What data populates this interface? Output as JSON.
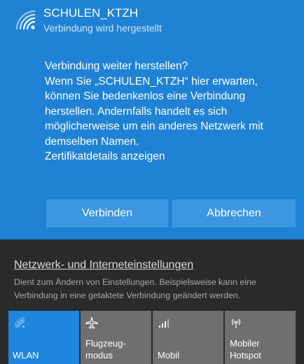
{
  "network": {
    "name": "SCHULEN_KTZH",
    "status": "Verbindung wird hergestellt"
  },
  "message": {
    "line1": "Verbindung weiter herstellen?",
    "body": "Wenn Sie „SCHULEN_KTZH“ hier erwarten, können Sie bedenkenlos eine Verbindung herstellen. Andernfalls handelt es sich möglicherweise um ein anderes Netzwerk mit demselben Namen.",
    "cert_link": "Zertifikatdetails anzeigen"
  },
  "buttons": {
    "connect": "Verbinden",
    "cancel": "Abbrechen"
  },
  "settings": {
    "link": "Netzwerk- und Interneteinstellungen",
    "description": "Dient zum Ändern von Einstellungen. Beispielsweise kann eine Verbindung in eine getaktete Verbindung geändert werden."
  },
  "tiles": [
    {
      "label": "WLAN",
      "icon": "wifi-icon",
      "active": true
    },
    {
      "label": "Flugzeug-\nmodus",
      "icon": "airplane-icon",
      "active": false
    },
    {
      "label": "Mobil",
      "icon": "cellular-icon",
      "active": false
    },
    {
      "label": "Mobiler\nHotspot",
      "icon": "hotspot-icon",
      "active": false
    }
  ],
  "colors": {
    "card": "#1f82d4",
    "button": "#3c97e0",
    "panel": "#2b2b2b",
    "tile": "#6f6f6f",
    "tile_active": "#1e86dc"
  }
}
